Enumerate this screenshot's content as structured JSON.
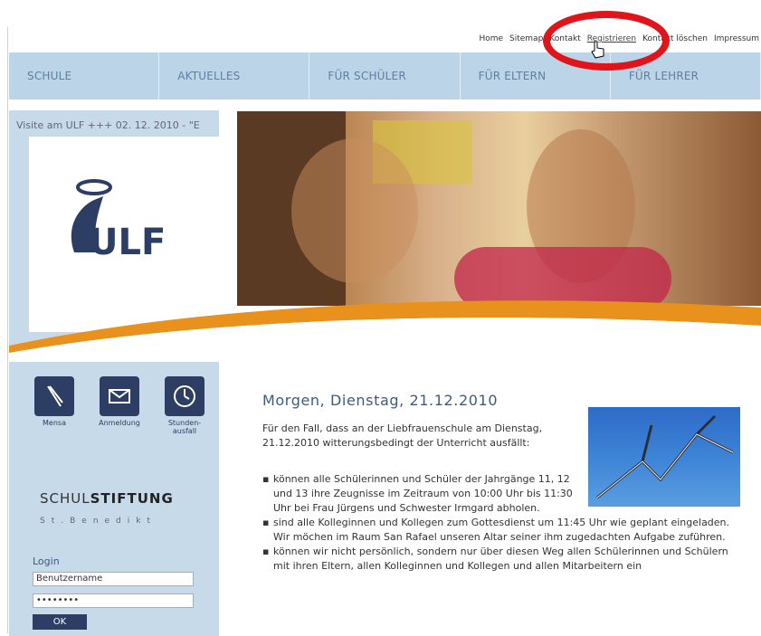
{
  "top_nav": [
    "Home",
    "Sitemap",
    "Kontakt",
    "Registrieren",
    "Kontakt löschen",
    "Impressum"
  ],
  "main_nav": [
    "SCHULE",
    "AKTUELLES",
    "FÜR SCHÜLER",
    "FÜR ELTERN",
    "FÜR LEHRER"
  ],
  "ticker": "Visite am ULF +++ 02. 12. 2010 - \"E",
  "logo_text": "ULF",
  "tiles": [
    {
      "label": "Mensa",
      "icon": "fork-knife-icon"
    },
    {
      "label": "Anmeldung",
      "icon": "envelope-icon"
    },
    {
      "label": "Stunden-ausfall",
      "icon": "clock-icon"
    }
  ],
  "stiftung": {
    "prefix": "SCHUL",
    "bold": "STIFTUNG",
    "sub": "St.Benedikt"
  },
  "login": {
    "label": "Login",
    "username": "Benutzername",
    "password": "••••••••",
    "ok": "OK"
  },
  "article": {
    "headline": "Morgen, Dienstag, 21.12.2010",
    "intro": "Für den Fall, dass an der Liebfrauenschule am Dienstag, 21.12.2010 witterungsbedingt der Unterricht ausfällt:",
    "items": [
      "können alle Schülerinnen und Schüler der Jahrgänge 11, 12 und 13 ihre Zeugnisse im Zeitraum von 10:00 Uhr bis 11:30 Uhr bei Frau Jürgens und Schwester Irmgard abholen.",
      "sind alle Kolleginnen und Kollegen zum Gottesdienst um 11:45 Uhr wie geplant eingeladen. Wir möchen im Raum San Rafael unseren Altar seiner ihm zugedachten Aufgabe zuführen.",
      "können wir nicht persönlich, sondern nur über diesen Weg allen Schülerinnen und Schülern mit ihren Eltern, allen Kolleginnen und Kollegen und allen Mitarbeitern ein"
    ]
  },
  "colors": {
    "nav_bg": "#bcd4e8",
    "nav_text": "#5b7fa5",
    "sidebar_bg": "#c7daea",
    "accent_orange": "#e8921d",
    "tile_bg": "#2c3e63",
    "annotation_red": "#e0141b"
  }
}
